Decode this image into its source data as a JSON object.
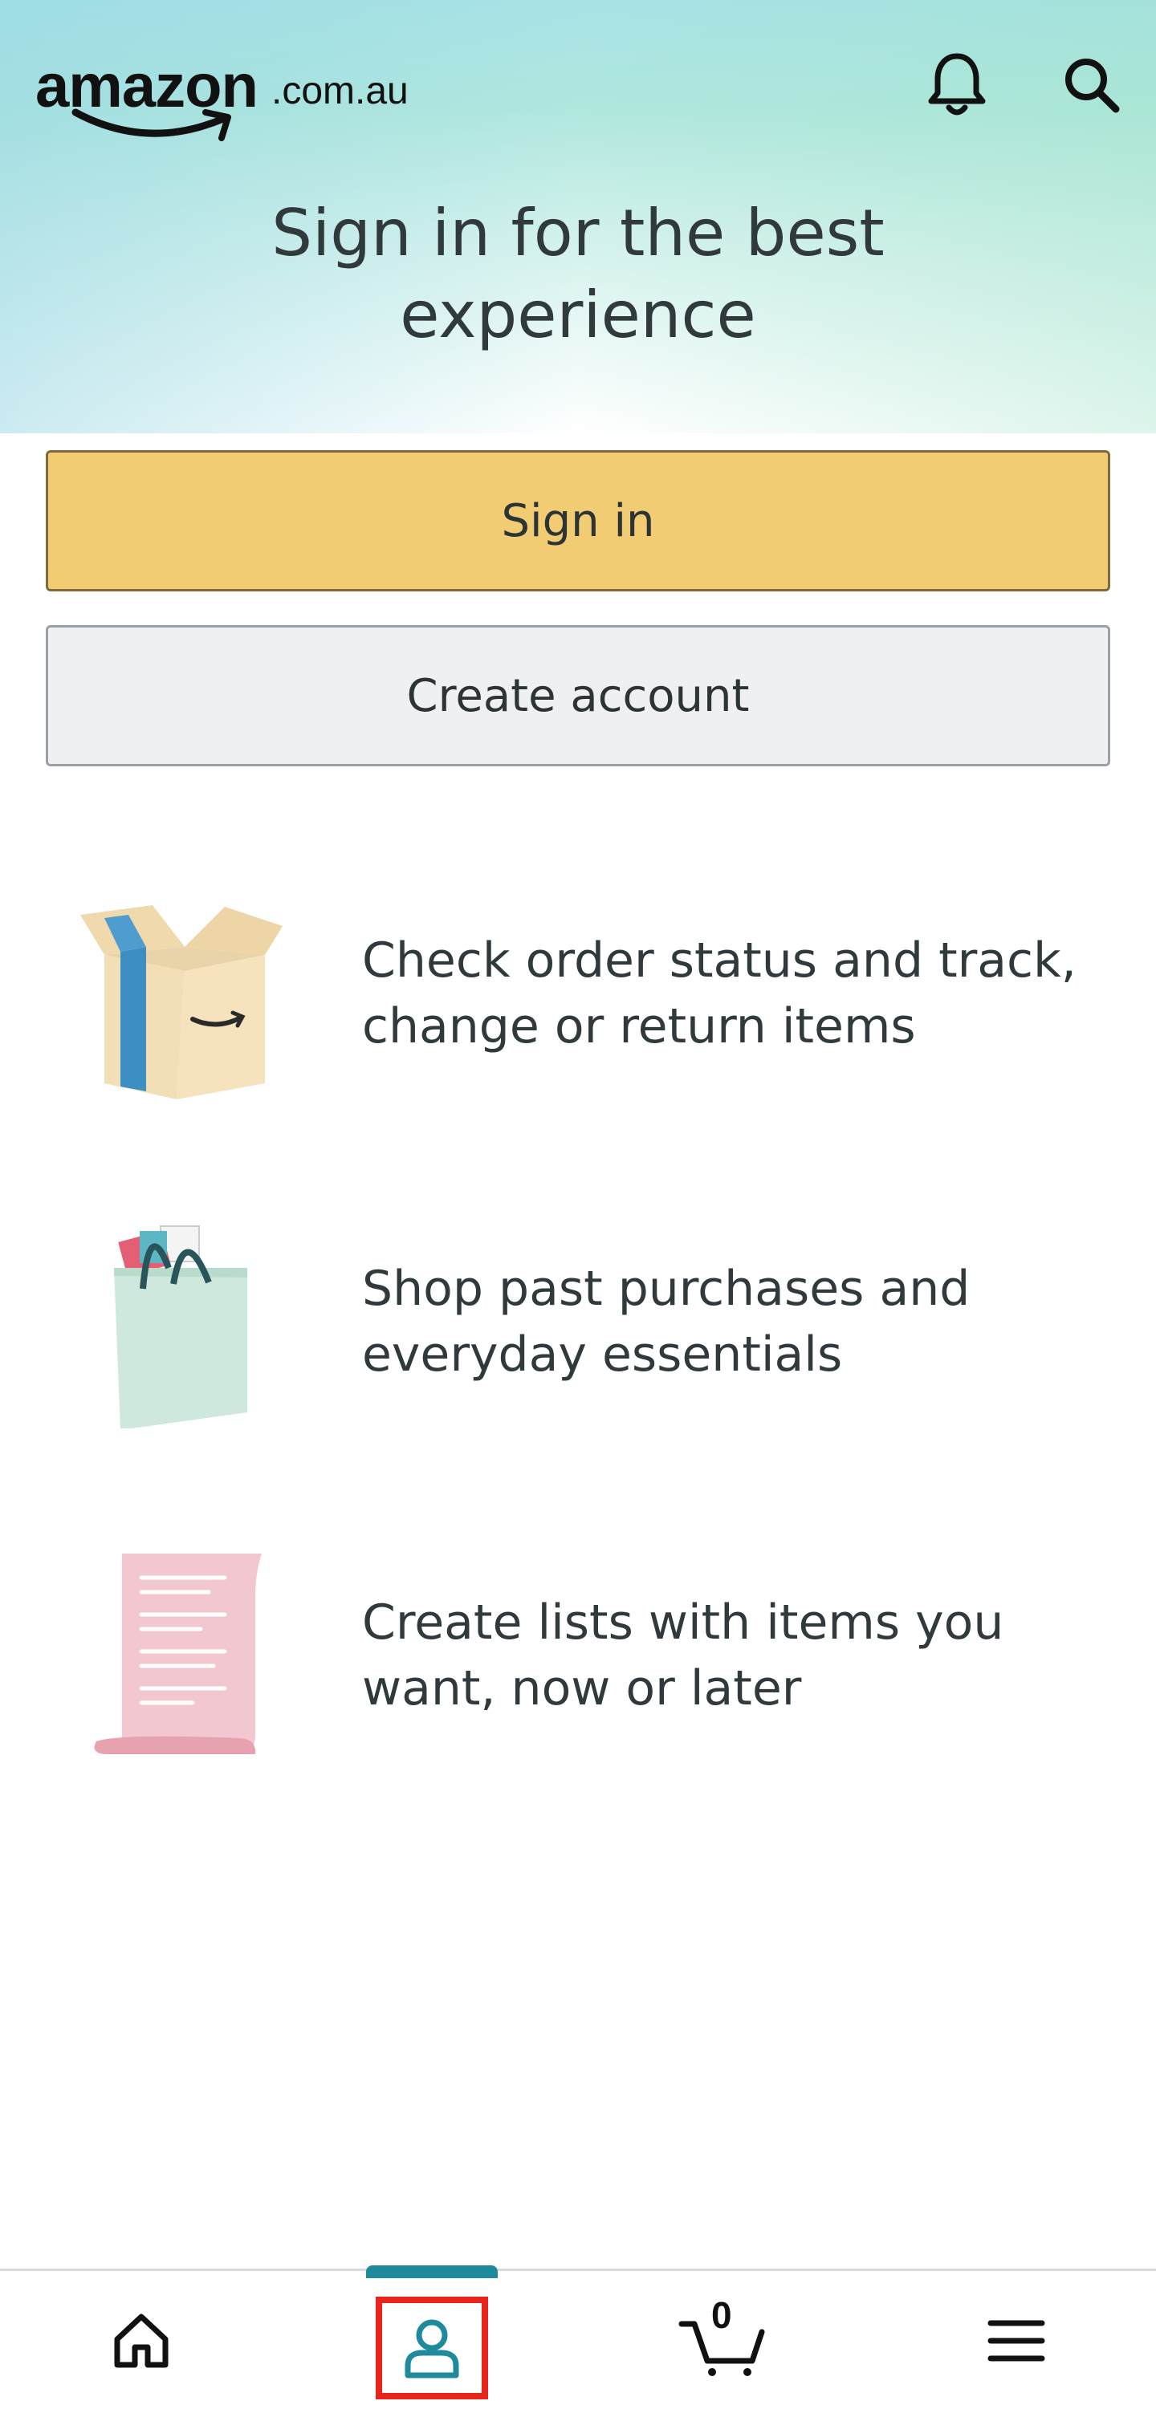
{
  "header": {
    "logo_word": "amazon",
    "logo_domain": ".com.au",
    "bell_icon": "bell-icon",
    "search_icon": "search-icon",
    "title": "Sign in for the best experience"
  },
  "buttons": {
    "sign_in": "Sign in",
    "create_account": "Create account"
  },
  "features": [
    {
      "icon": "box-icon",
      "text": "Check order status and track, change or return items"
    },
    {
      "icon": "shopping-bag-icon",
      "text": "Shop past purchases and everyday essentials"
    },
    {
      "icon": "list-scroll-icon",
      "text": "Create lists with items you want, now or later"
    }
  ],
  "bottom_nav": {
    "items": [
      {
        "name": "home",
        "icon": "home-icon"
      },
      {
        "name": "profile",
        "icon": "person-icon"
      },
      {
        "name": "cart",
        "icon": "cart-icon",
        "count": "0"
      },
      {
        "name": "menu",
        "icon": "hamburger-icon"
      }
    ]
  },
  "colors": {
    "sign_in_bg": "#f2cc72",
    "create_bg": "#eff0f3",
    "accent": "#1f8a9c",
    "highlight": "#e8241b"
  }
}
